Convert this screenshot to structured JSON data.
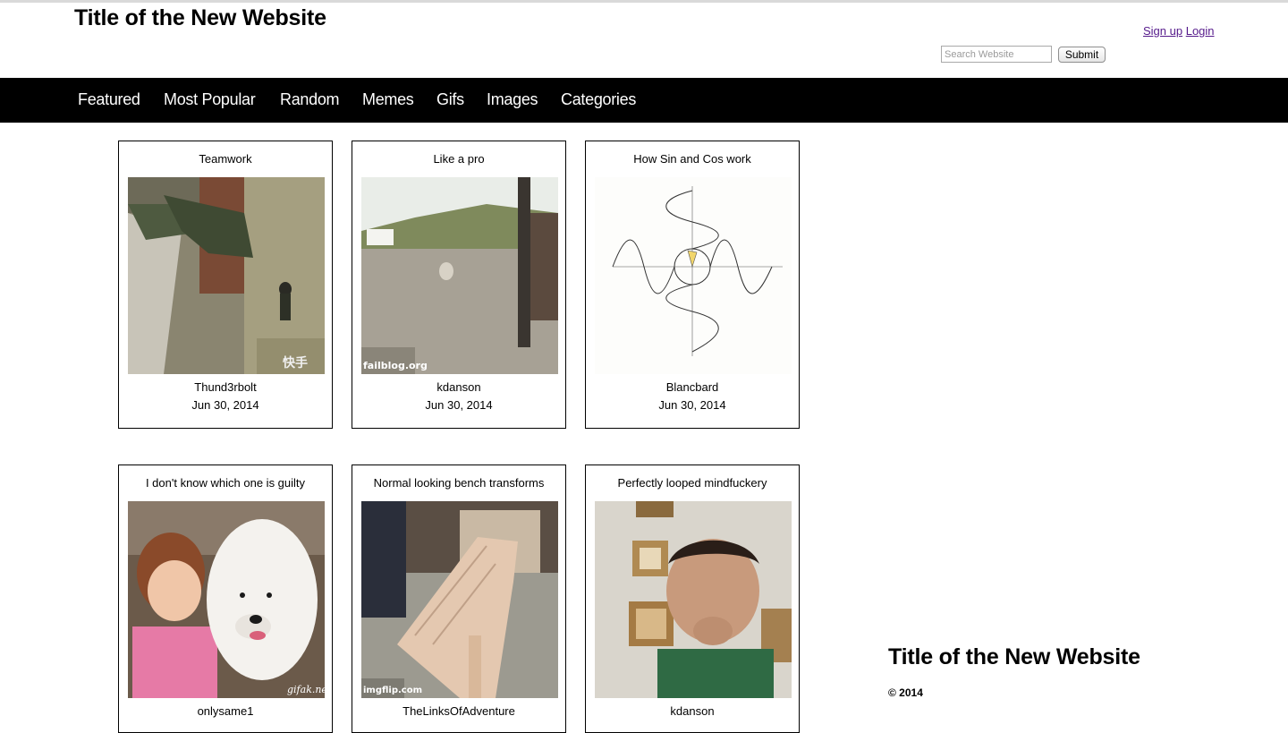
{
  "header": {
    "title": "Title of the New Website",
    "signup_label": "Sign up",
    "login_label": "Login",
    "search_placeholder": "Search Website",
    "submit_label": "Submit"
  },
  "nav": {
    "items": [
      "Featured",
      "Most Popular",
      "Random",
      "Memes",
      "Gifs",
      "Images",
      "Categories"
    ]
  },
  "posts": [
    {
      "title": "Teamwork",
      "author": "Thund3rbolt",
      "date": "Jun 30, 2014",
      "image": "soldier-climbing-wall-gif",
      "watermark": "快手"
    },
    {
      "title": "Like a pro",
      "author": "kdanson",
      "date": "Jun 30, 2014",
      "image": "sandy-beach-fall-gif",
      "watermark": "failblog.org"
    },
    {
      "title": "How Sin and Cos work",
      "author": "Blancbard",
      "date": "Jun 30, 2014",
      "image": "sin-cos-diagram-gif",
      "watermark": ""
    },
    {
      "title": "I don't know which one is guilty",
      "author": "onlysame1",
      "date": "",
      "image": "girl-and-white-dog-gif",
      "watermark": "gifak.net"
    },
    {
      "title": "Normal looking bench transforms",
      "author": "TheLinksOfAdventure",
      "date": "",
      "image": "wooden-bench-gif",
      "watermark": "imgflip.com"
    },
    {
      "title": "Perfectly looped mindfuckery",
      "author": "kdanson",
      "date": "",
      "image": "man-looking-up-gif",
      "watermark": ""
    }
  ],
  "footer": {
    "title": "Title of the New Website",
    "copyright": "© 2014"
  },
  "colors": {
    "navbar_bg": "#000000",
    "link_visited": "#551a8b"
  }
}
